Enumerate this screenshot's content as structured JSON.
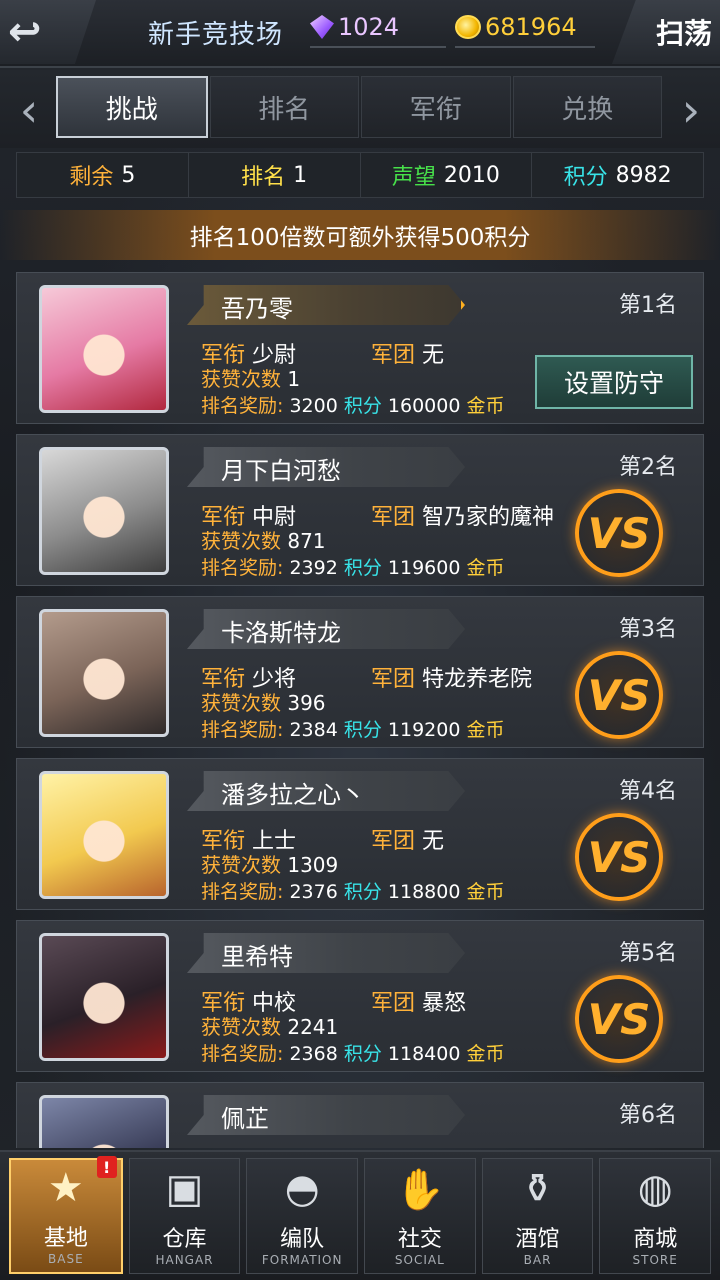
{
  "header": {
    "back_icon": "back-arrow-icon",
    "title": "新手竞技场",
    "gems": "1024",
    "coins": "681964",
    "sweep_label": "扫荡"
  },
  "tabs": [
    {
      "label": "挑战",
      "active": true
    },
    {
      "label": "排名",
      "active": false
    },
    {
      "label": "军衔",
      "active": false
    },
    {
      "label": "兑换",
      "active": false
    }
  ],
  "stats": {
    "remaining_label": "剩余",
    "remaining_value": "5",
    "rank_label": "排名",
    "rank_value": "1",
    "prestige_label": "声望",
    "prestige_value": "2010",
    "points_label": "积分",
    "points_value": "8982"
  },
  "banner": "排名100倍数可额外获得500积分",
  "labels": {
    "rank_title": "军衔",
    "legion": "军团",
    "likes": "获赞次数",
    "reward": "排名奖励:",
    "points_unit": "积分",
    "coin_unit": "金币",
    "set_defense": "设置防守",
    "vs": "VS"
  },
  "opponents": [
    {
      "name": "吾乃零",
      "rank": "第1名",
      "title": "少尉",
      "legion": "无",
      "likes": "1",
      "reward_points": "3200",
      "reward_coins": "160000",
      "is_self": true
    },
    {
      "name": "月下白河愁",
      "rank": "第2名",
      "title": "中尉",
      "legion": "智乃家的魔神",
      "likes": "871",
      "reward_points": "2392",
      "reward_coins": "119600",
      "is_self": false
    },
    {
      "name": "卡洛斯特龙",
      "rank": "第3名",
      "title": "少将",
      "legion": "特龙养老院",
      "likes": "396",
      "reward_points": "2384",
      "reward_coins": "119200",
      "is_self": false
    },
    {
      "name": "潘多拉之心丶",
      "rank": "第4名",
      "title": "上士",
      "legion": "无",
      "likes": "1309",
      "reward_points": "2376",
      "reward_coins": "118800",
      "is_self": false
    },
    {
      "name": "里希特",
      "rank": "第5名",
      "title": "中校",
      "legion": "暴怒",
      "likes": "2241",
      "reward_points": "2368",
      "reward_coins": "118400",
      "is_self": false
    },
    {
      "name": "佩芷",
      "rank": "第6名",
      "is_self": false
    }
  ],
  "bottom_nav": [
    {
      "label": "基地",
      "sub": "BASE",
      "icon": "base-emblem-icon",
      "active": true,
      "badge": "!"
    },
    {
      "label": "仓库",
      "sub": "HANGAR",
      "icon": "hangar-icon",
      "active": false
    },
    {
      "label": "编队",
      "sub": "FORMATION",
      "icon": "formation-helmet-icon",
      "active": false
    },
    {
      "label": "社交",
      "sub": "SOCIAL",
      "icon": "handshake-icon",
      "active": false
    },
    {
      "label": "酒馆",
      "sub": "BAR",
      "icon": "bar-icon",
      "active": false
    },
    {
      "label": "商城",
      "sub": "STORE",
      "icon": "store-icon",
      "active": false
    }
  ]
}
